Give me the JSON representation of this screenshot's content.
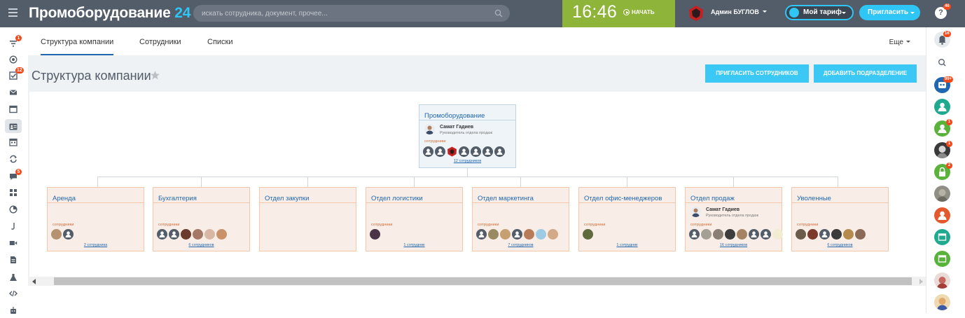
{
  "header": {
    "logo_text": "Промоборудование",
    "logo_number": "24",
    "search_placeholder": "искать сотрудника, документ, прочее...",
    "clock": "16:46",
    "start_label": "НАЧАТЬ",
    "user_name": "Админ БУГЛОВ",
    "tariff_label": "Мой тариф",
    "invite_label": "Пригласить",
    "help_label": "?",
    "help_badge": "46"
  },
  "left_menu": {
    "badges": {
      "filter": "1",
      "tasks": "12",
      "chat": "5"
    }
  },
  "right_panel": {
    "badges": {
      "notifications": "16",
      "group_chat": "99+",
      "user2": "1",
      "user3": "1",
      "user4": "2"
    }
  },
  "tabs": [
    {
      "label": "Структура компании",
      "active": true
    },
    {
      "label": "Сотрудники",
      "active": false
    },
    {
      "label": "Списки",
      "active": false
    }
  ],
  "more_label": "Еще",
  "page": {
    "title": "Структура компании",
    "invite_button": "ПРИГЛАСИТЬ СОТРУДНИКОВ",
    "add_dept_button": "ДОБАВИТЬ ПОДРАЗДЕЛЕНИЕ"
  },
  "structure": {
    "employees_label": "сотрудники",
    "root": {
      "title": "Промоборудование",
      "head_name": "Самат Гадиев",
      "head_position": "Руководитель отдела продаж",
      "count_label": "12 сотрудников"
    },
    "departments": [
      {
        "title": "Аренда",
        "count_label": "2 сотрудника"
      },
      {
        "title": "Бухгалтерия",
        "count_label": "6 сотрудников"
      },
      {
        "title": "Отдел закупки",
        "count_label": ""
      },
      {
        "title": "Отдел логистики",
        "count_label": "1 сотрудник"
      },
      {
        "title": "Отдел маркетинга",
        "count_label": "7 сотрудников"
      },
      {
        "title": "Отдел офис-менеджеров",
        "count_label": "1 сотрудник"
      },
      {
        "title": "Отдел продаж",
        "count_label": "16 сотрудников",
        "head_name": "Самат Гадиев",
        "head_position": "Руководитель отдела продаж"
      },
      {
        "title": "Уволенные",
        "count_label": "6 сотрудников"
      }
    ]
  },
  "colors": {
    "header_bg": "#535c69",
    "accent": "#2fc6f6",
    "clock_bg": "#8fb43a",
    "link": "#2067b0",
    "badge": "#f54819"
  }
}
